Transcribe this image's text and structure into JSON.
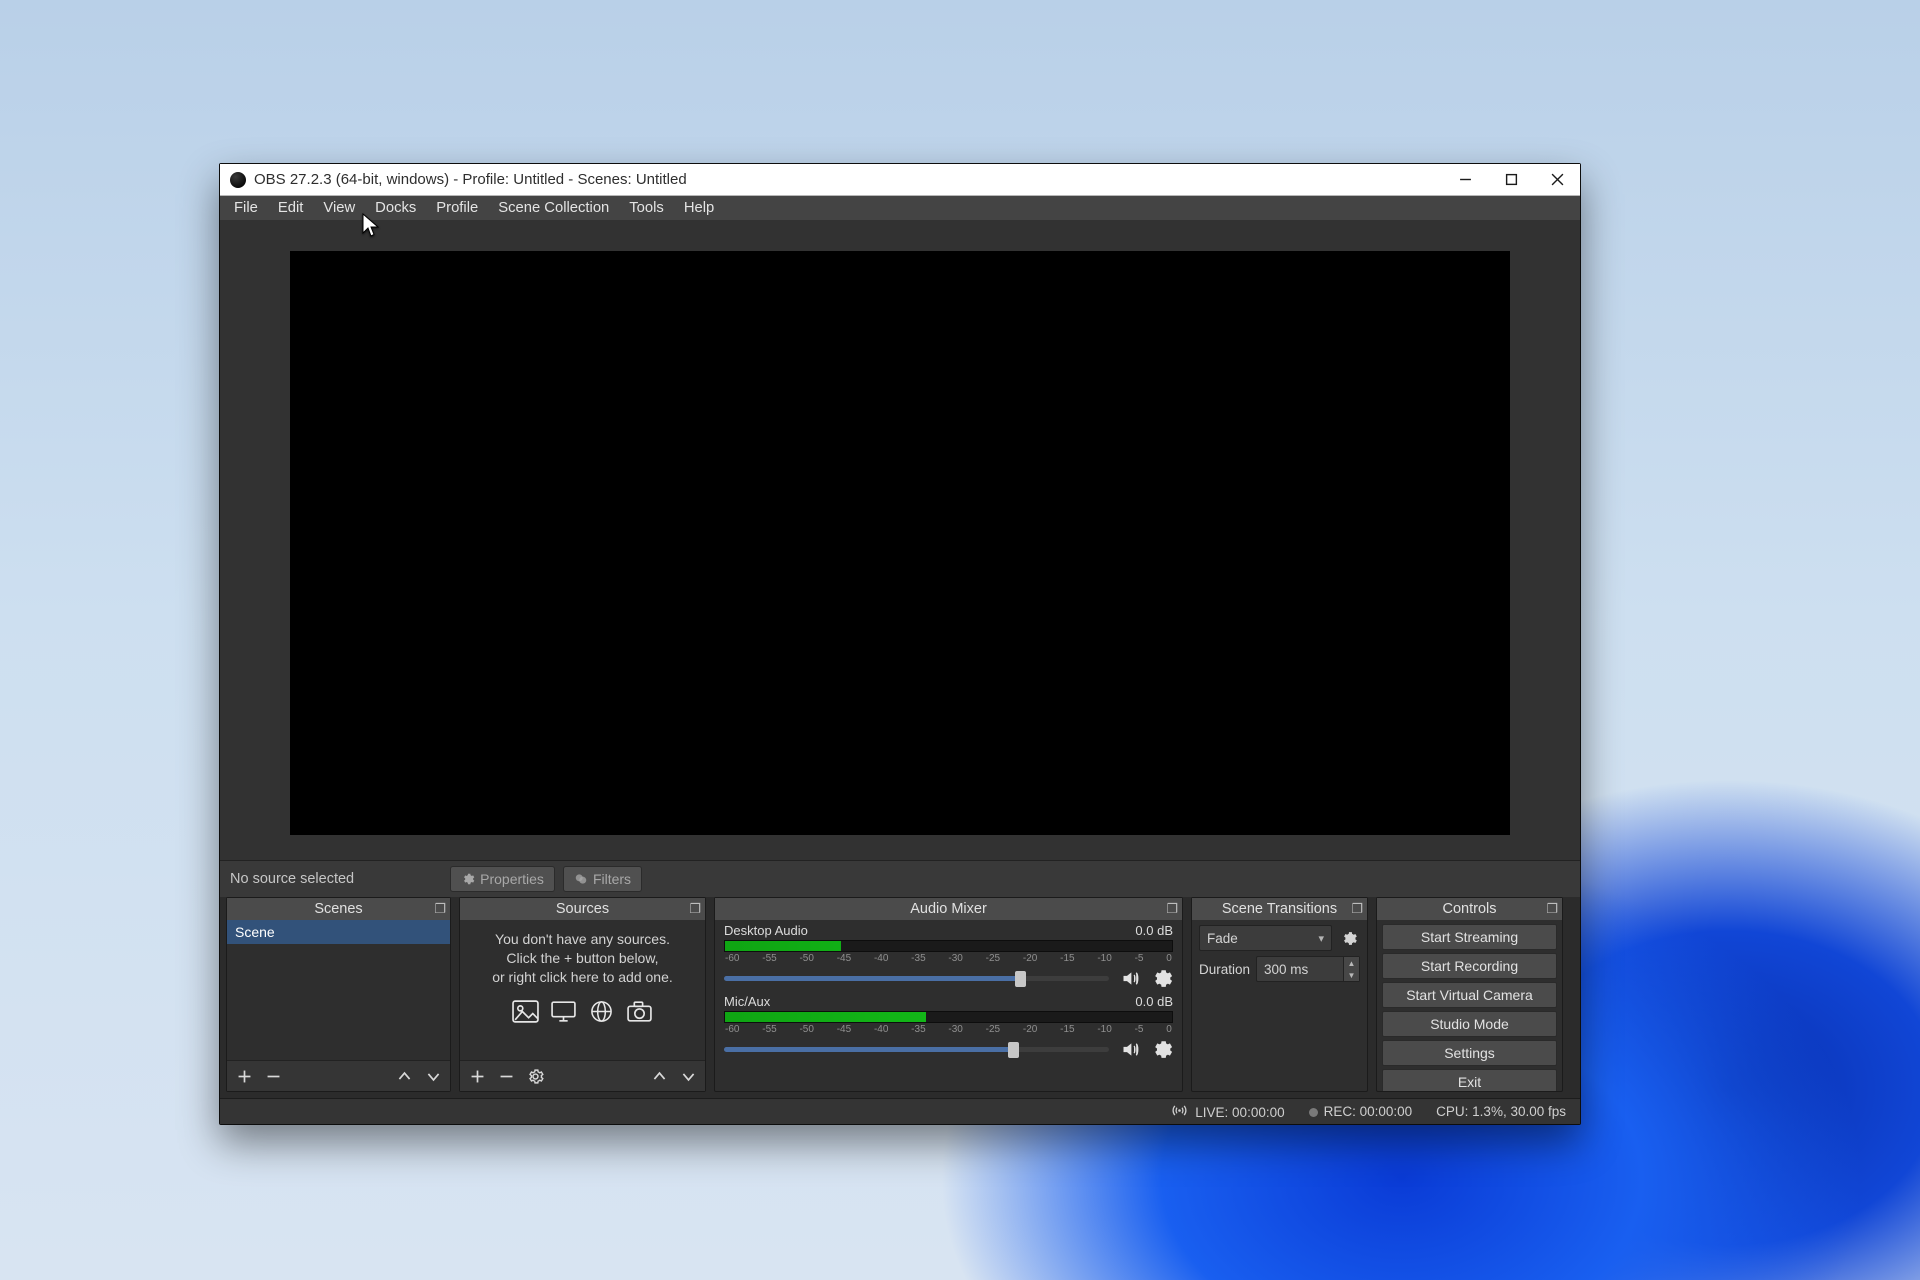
{
  "titlebar": {
    "title": "OBS 27.2.3 (64-bit, windows) - Profile: Untitled - Scenes: Untitled"
  },
  "menu": {
    "items": [
      "File",
      "Edit",
      "View",
      "Docks",
      "Profile",
      "Scene Collection",
      "Tools",
      "Help"
    ]
  },
  "source_toolbar": {
    "status": "No source selected",
    "properties_label": "Properties",
    "filters_label": "Filters"
  },
  "docks": {
    "scenes": {
      "title": "Scenes",
      "items": [
        "Scene"
      ]
    },
    "sources": {
      "title": "Sources",
      "empty_line1": "You don't have any sources.",
      "empty_line2": "Click the + button below,",
      "empty_line3": "or right click here to add one."
    },
    "mixer": {
      "title": "Audio Mixer",
      "channels": [
        {
          "name": "Desktop Audio",
          "level": "0.0 dB"
        },
        {
          "name": "Mic/Aux",
          "level": "0.0 dB"
        }
      ],
      "ticks": [
        "-60",
        "-55",
        "-50",
        "-45",
        "-40",
        "-35",
        "-30",
        "-25",
        "-20",
        "-15",
        "-10",
        "-5",
        "0"
      ]
    },
    "transitions": {
      "title": "Scene Transitions",
      "mode": "Fade",
      "duration_label": "Duration",
      "duration_value": "300 ms"
    },
    "controls": {
      "title": "Controls",
      "buttons": [
        "Start Streaming",
        "Start Recording",
        "Start Virtual Camera",
        "Studio Mode",
        "Settings",
        "Exit"
      ]
    }
  },
  "statusbar": {
    "live": "LIVE: 00:00:00",
    "rec": "REC: 00:00:00",
    "cpu": "CPU: 1.3%, 30.00 fps"
  }
}
